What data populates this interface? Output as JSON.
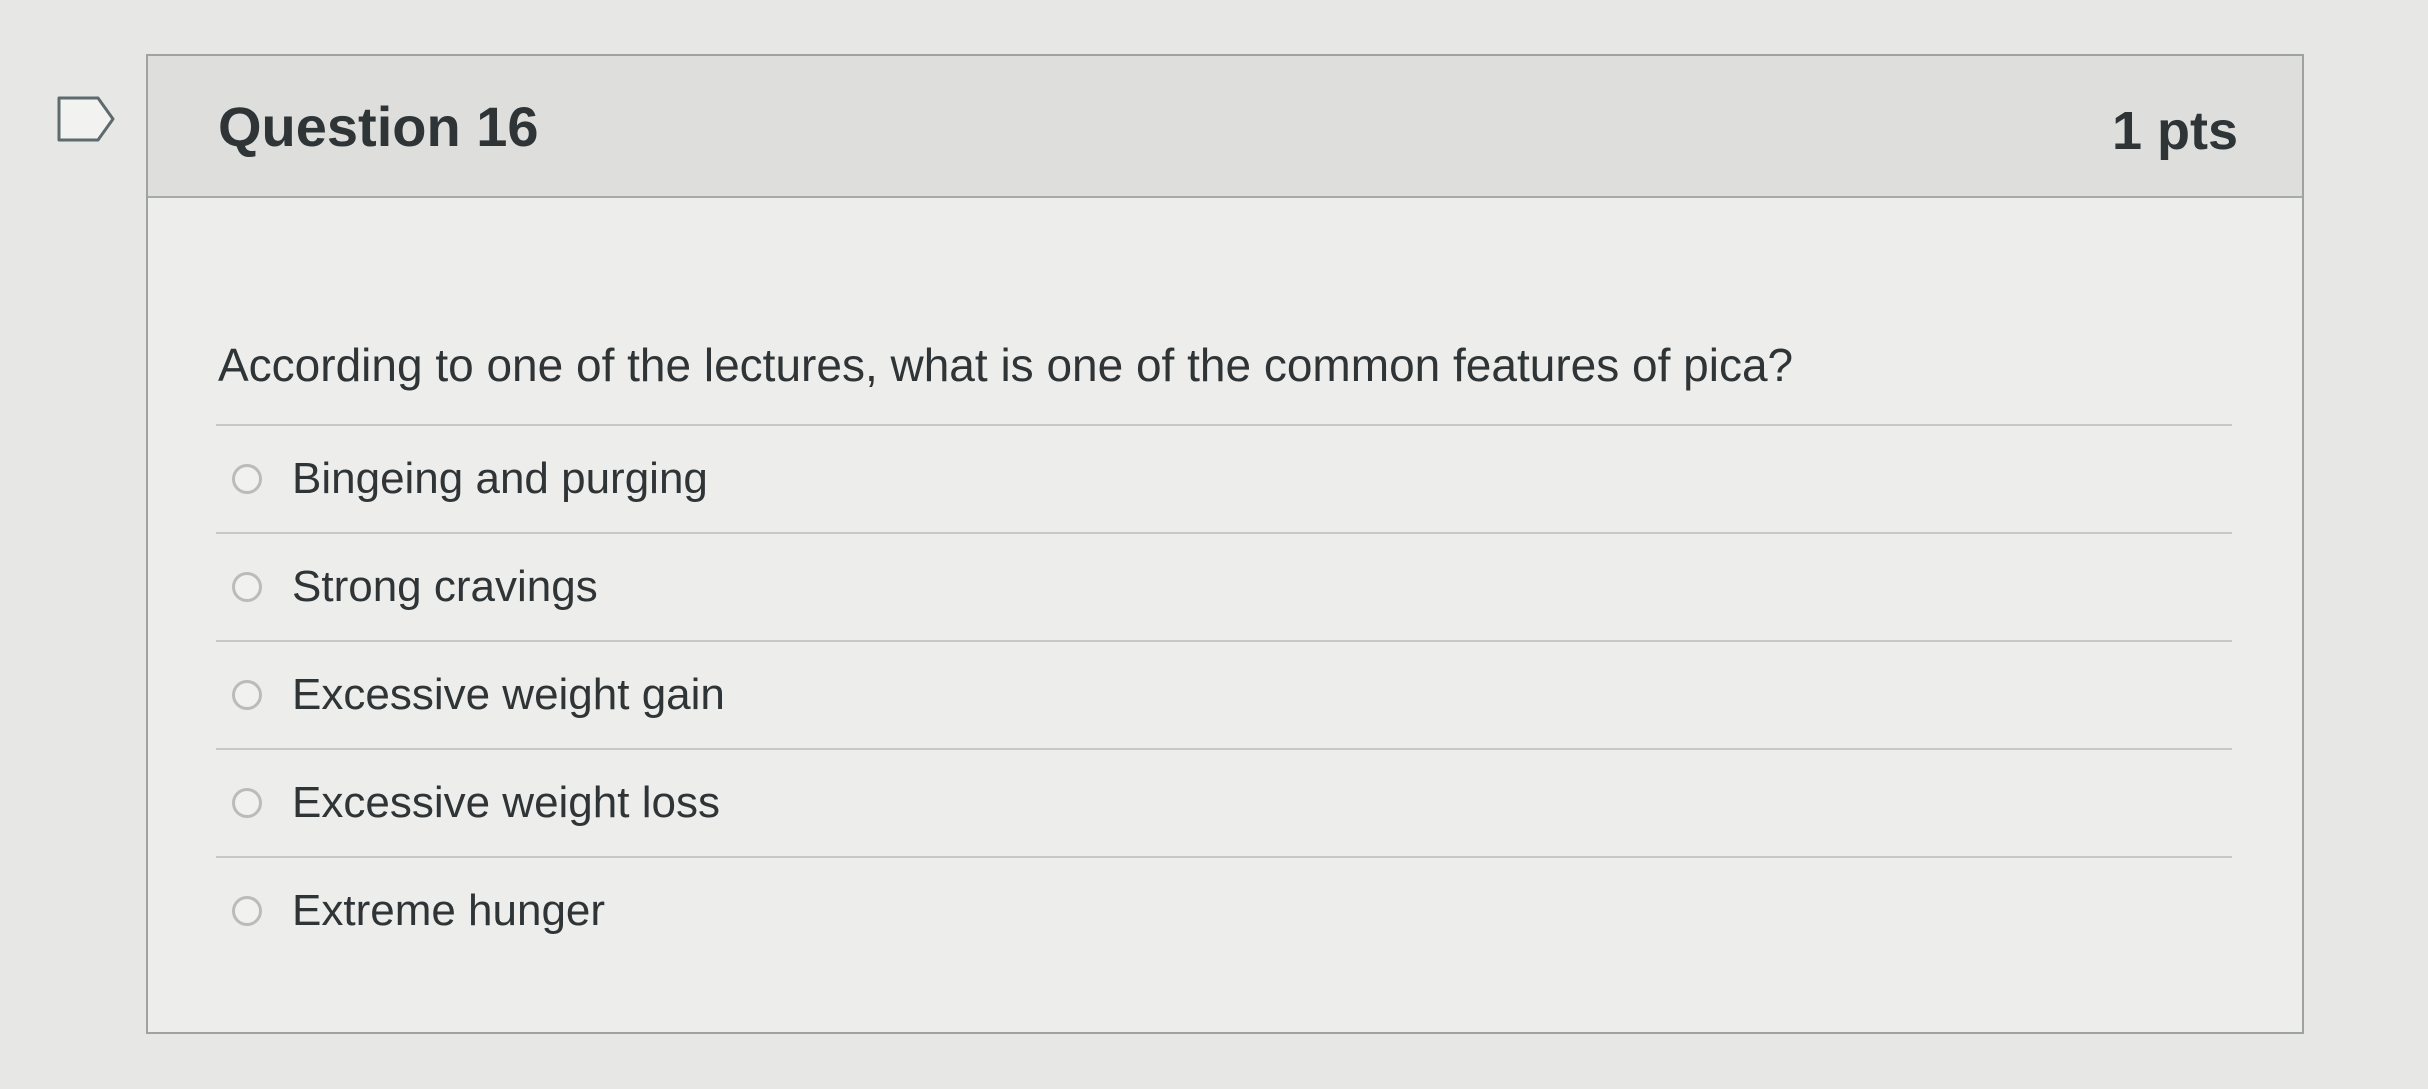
{
  "question": {
    "title": "Question 16",
    "points": "1 pts",
    "text": "According to one of the lectures, what is one of the common features of pica?",
    "answers": [
      {
        "label": "Bingeing and purging"
      },
      {
        "label": "Strong cravings"
      },
      {
        "label": "Excessive weight gain"
      },
      {
        "label": "Excessive weight loss"
      },
      {
        "label": "Extreme hunger"
      }
    ]
  },
  "icons": {
    "flag": "flag-question-icon",
    "radio": "radio-unselected"
  },
  "colors": {
    "page_background": "#e7e8e5",
    "header_background": "#dedfdd",
    "text": "#2f3437",
    "border": "#9ea3a2"
  }
}
